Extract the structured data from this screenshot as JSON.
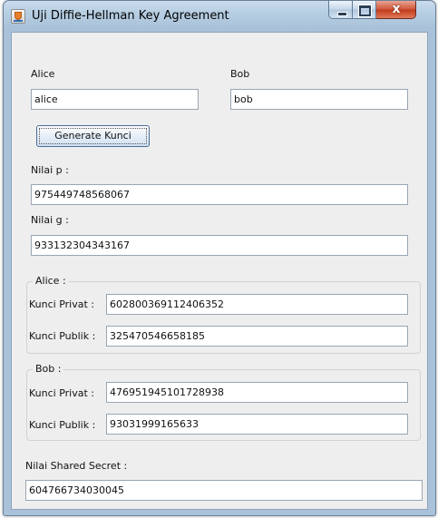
{
  "window": {
    "title": "Uji Diffie-Hellman Key Agreement",
    "close_symbol": "x"
  },
  "alice": {
    "label": "Alice",
    "value": "alice"
  },
  "bob": {
    "label": "Bob",
    "value": "bob"
  },
  "generate_button": {
    "label": "Generate Kunci"
  },
  "p": {
    "label": "Nilai p :",
    "value": "975449748568067"
  },
  "g": {
    "label": "Nilai g :",
    "value": "933132304343167"
  },
  "alice_keys": {
    "title": "Alice :",
    "private_label": "Kunci Privat :",
    "private_value": "602800369112406352",
    "public_label": "Kunci Publik :",
    "public_value": "325470546658185"
  },
  "bob_keys": {
    "title": "Bob :",
    "private_label": "Kunci Privat :",
    "private_value": "476951945101728938",
    "public_label": "Kunci Publik :",
    "public_value": "93031999165633"
  },
  "shared_secret": {
    "label": "Nilai Shared Secret :",
    "value": "604766734030045"
  }
}
